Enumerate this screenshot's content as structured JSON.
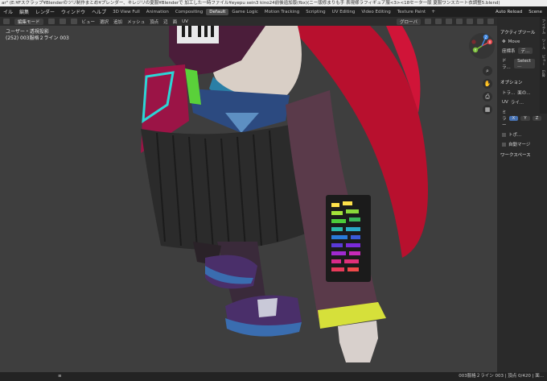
{
  "window": {
    "title": "ar\" (E:¥Fスクラップ¥Blenderのツリ制作まとめ¥プレンダー、キレジリの夏服¥Blenderで 加工した一時ファイル¥eyepu sein3  kino24前後追加版(fbx)(ニー版修まりも手 表現様ラフィギュア服<3><18セータ一版 夏服ワンスカート衣調整5.blend)"
  },
  "menu": {
    "items": [
      "イル",
      "編集",
      "レンダー",
      "ウィンドウ",
      "ヘルプ"
    ],
    "workspaces": [
      "3D View Full",
      "Animation",
      "Compositing",
      "Default",
      "Game Logic",
      "Motion Tracking",
      "Scripting",
      "UV Editing",
      "Video Editing",
      "Texture Paint"
    ],
    "active_workspace": "Default",
    "plus": "+",
    "auto_reload": "Auto Reload",
    "scene": "Scene"
  },
  "header": {
    "mode": "編集モード",
    "menus": [
      "ビュー",
      "選択",
      "追加",
      "メッシュ",
      "頂点",
      "辺",
      "面",
      "UV"
    ],
    "transform": "グローバ"
  },
  "viewport": {
    "projection": "ユーザー・透視投影",
    "object": "(252) 003服格２ライン 003"
  },
  "gizmo": {
    "x": "X",
    "y": "Y",
    "z": "Z",
    "neg": "-X",
    "colors": {
      "x": "#e5484d",
      "y": "#7bbf3a",
      "z": "#3f86e0"
    }
  },
  "npanel": {
    "tool_header": "アクティブツール",
    "tool_name": "Move",
    "axis_label": "座標系",
    "axis_value": "デ...",
    "drag_label": "ドラ...",
    "drag_value": "Select ...",
    "options_header": "オプション",
    "transform_label": "トラ...",
    "transform_value": "面の...",
    "uv_label": "UV",
    "uv_value": "ライ...",
    "mirror_label": "ミラー",
    "mirror_x": "X",
    "mirror_y": "Y",
    "mirror_z": "Z",
    "topo": "トポ...",
    "auto_merge": "自動マージ",
    "workspace_label": "ワークスペース",
    "tabs": [
      "アイテム",
      "ツール",
      "ビュー",
      "Edit"
    ]
  },
  "status": {
    "left_icon": "≡",
    "text": "003服格２ライン 003 | 頂点 0/420 | 面..."
  }
}
